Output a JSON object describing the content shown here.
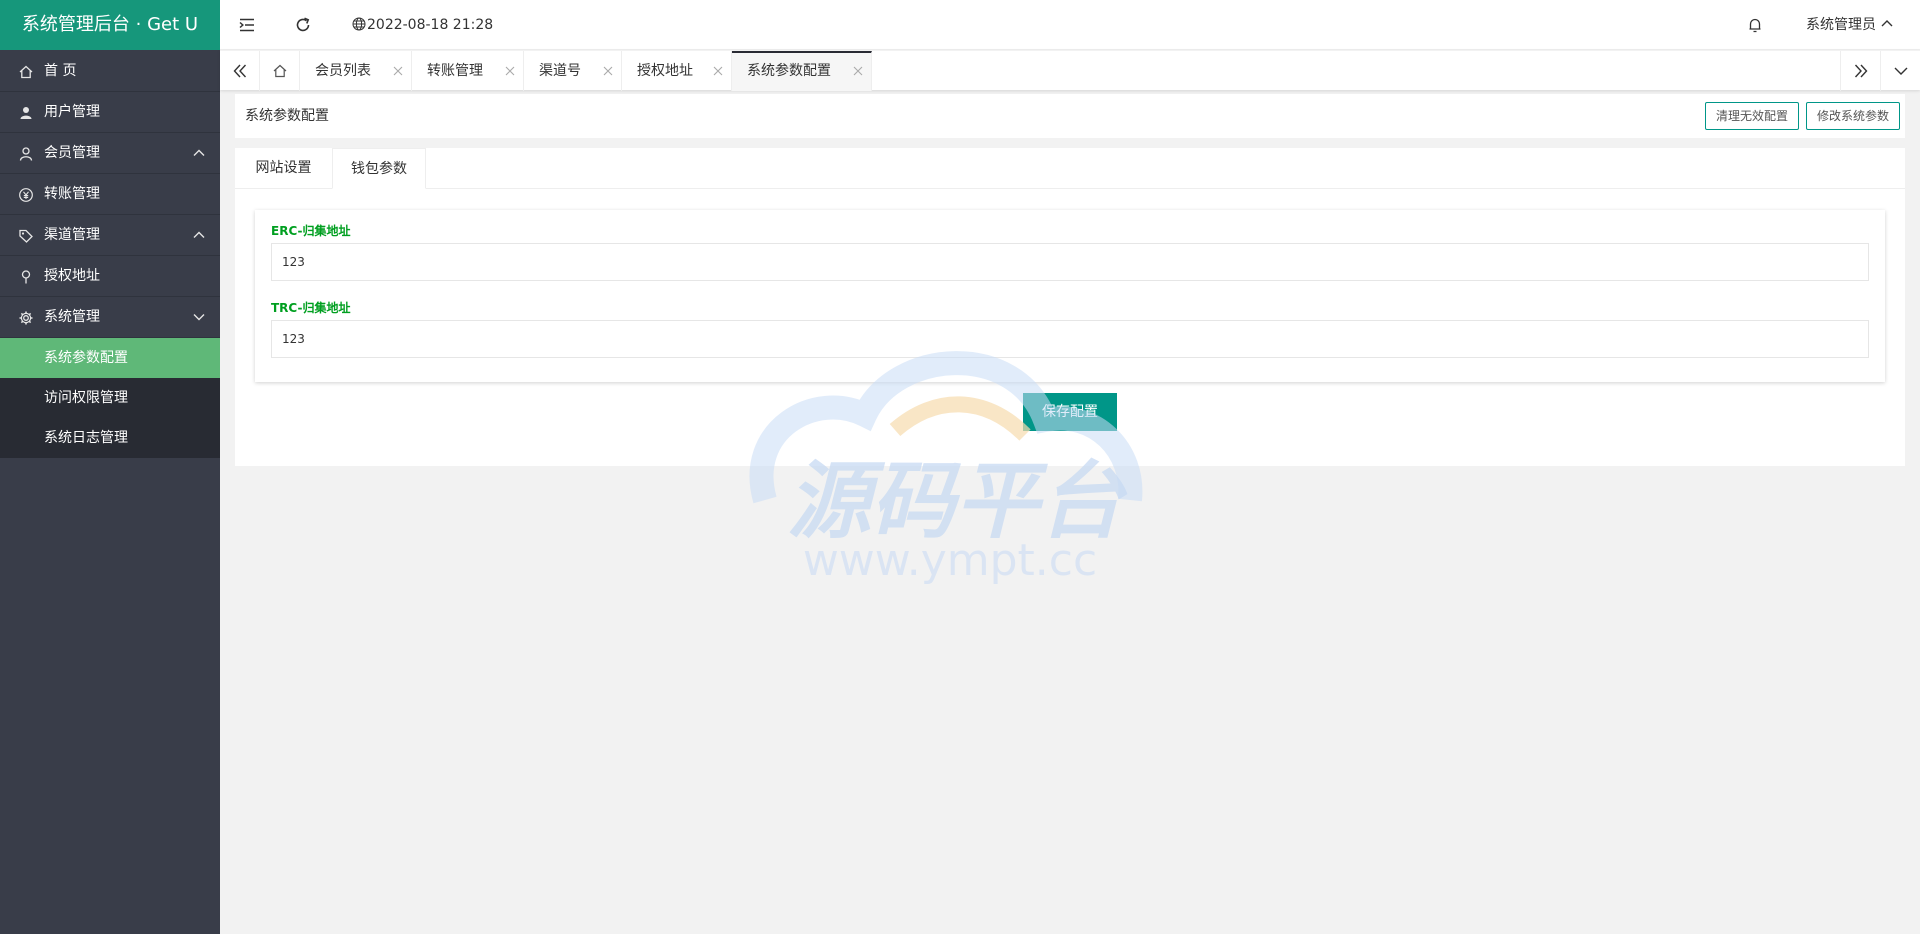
{
  "app": {
    "title": "系统管理后台 · Get U"
  },
  "sidebar": {
    "items": [
      {
        "label": "首 页",
        "icon": "home-icon"
      },
      {
        "label": "用户管理",
        "icon": "user-icon"
      },
      {
        "label": "会员管理",
        "icon": "member-icon",
        "arrow": "chevron-up"
      },
      {
        "label": "转账管理",
        "icon": "yen-icon"
      },
      {
        "label": "渠道管理",
        "icon": "tag-icon",
        "arrow": "chevron-up"
      },
      {
        "label": "授权地址",
        "icon": "location-icon"
      },
      {
        "label": "系统管理",
        "icon": "gear-icon",
        "arrow": "chevron-down"
      }
    ],
    "submenu": [
      {
        "label": "系统参数配置",
        "active": true
      },
      {
        "label": "访问权限管理"
      },
      {
        "label": "系统日志管理"
      }
    ]
  },
  "header": {
    "datetime": "2022-08-18 21:28",
    "user": "系统管理员"
  },
  "tabs": [
    {
      "label": "会员列表"
    },
    {
      "label": "转账管理"
    },
    {
      "label": "渠道号"
    },
    {
      "label": "授权地址"
    },
    {
      "label": "系统参数配置",
      "active": true
    }
  ],
  "page": {
    "title": "系统参数配置",
    "clean_button": "清理无效配置",
    "edit_button": "修改系统参数"
  },
  "panel": {
    "tabs": [
      {
        "label": "网站设置"
      },
      {
        "label": "钱包参数",
        "active": true
      }
    ],
    "fields": [
      {
        "label": "ERC-归集地址",
        "value": "123"
      },
      {
        "label": "TRC-归集地址",
        "value": "123"
      }
    ],
    "save_button": "保存配置"
  },
  "watermark": {
    "text_cn": "源码平台",
    "text_url": "www.ympt.cc"
  },
  "colors": {
    "logo_bg": "#16977b",
    "sidebar_bg": "#393d49",
    "submenu_bg": "#282b33",
    "active_sub": "#5fb878",
    "accent": "#009688",
    "label_green": "#009f20"
  }
}
